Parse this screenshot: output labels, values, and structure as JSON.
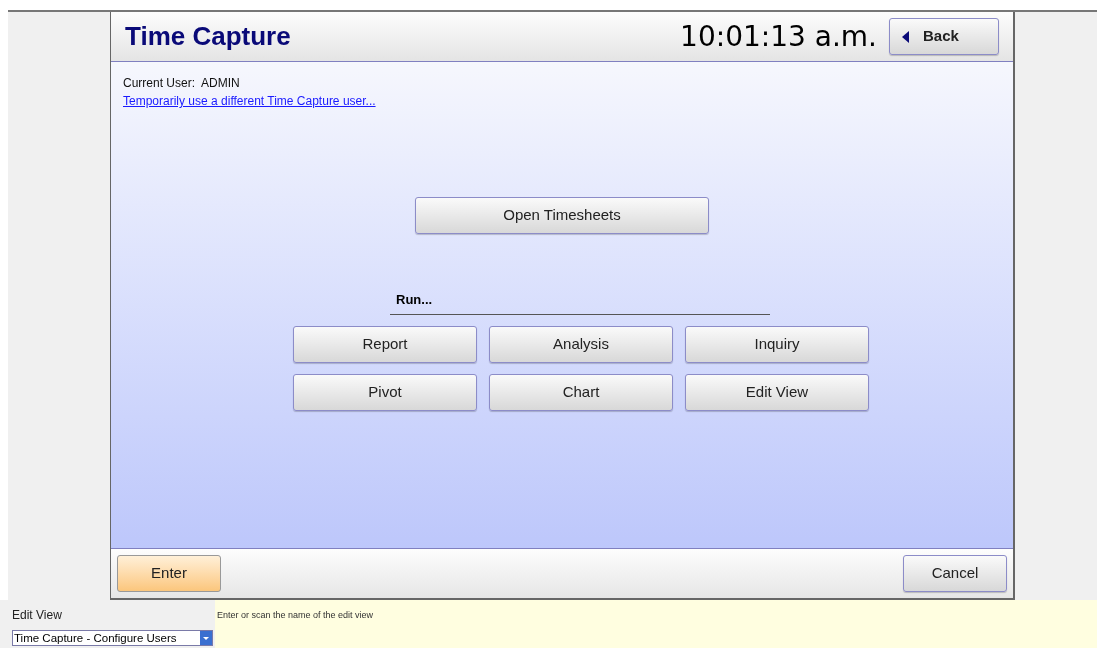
{
  "window": {
    "title": "Time Capture",
    "clock": "10:01:13 a.m.",
    "back_button": "Back"
  },
  "user": {
    "label": "Current User:  ADMIN",
    "switch_link": "Temporarily use a different Time Capture user..."
  },
  "main_button": "Open Timesheets",
  "run": {
    "label": "Run...",
    "buttons": [
      "Report",
      "Analysis",
      "Inquiry",
      "Pivot",
      "Chart",
      "Edit View"
    ]
  },
  "footer": {
    "enter_button": "Enter",
    "cancel_button": "Cancel"
  },
  "bottom": {
    "field_label": "Edit View",
    "field_value": "Time Capture - Configure Users",
    "hint": "Enter or scan the name of the edit view"
  }
}
